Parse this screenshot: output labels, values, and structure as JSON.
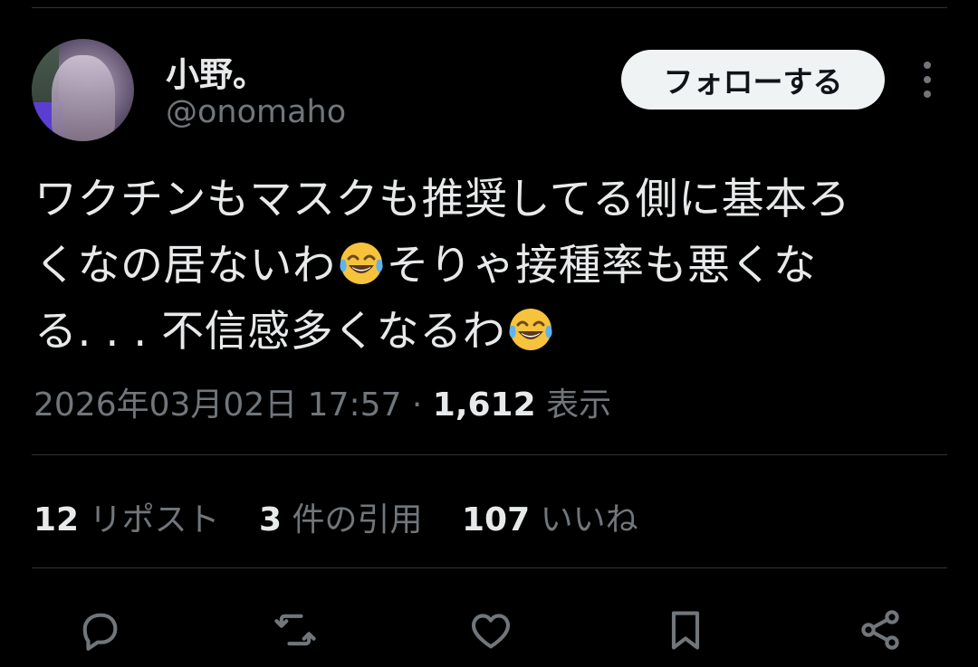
{
  "user": {
    "display_name": "小野。",
    "handle": "@onomaho",
    "follow_label": "フォローする"
  },
  "tweet": {
    "text_line1": "ワクチンもマスクも推奨してる側に基本ろ",
    "text_line2a": "くなの居ないわ",
    "text_line2b": "そりゃ接種率も悪くな",
    "text_line3": "る. . . 不信感多くなるわ",
    "emoji": "face-with-tears-of-joy"
  },
  "meta": {
    "timestamp": "2026年03月02日 17:57",
    "separator": " · ",
    "views_count": "1,612",
    "views_label": " 表示"
  },
  "stats": {
    "reposts_count": "12",
    "reposts_label": " リポスト",
    "quotes_count": "3",
    "quotes_label": " 件の引用",
    "likes_count": "107",
    "likes_label": " いいね"
  },
  "actions": [
    "reply-icon",
    "repost-icon",
    "like-icon",
    "bookmark-icon",
    "share-icon"
  ],
  "colors": {
    "background": "#000000",
    "primary_text": "#e7e9ea",
    "secondary_text": "#71767b",
    "divider": "#2f3336",
    "follow_button_bg": "#eff3f4"
  }
}
